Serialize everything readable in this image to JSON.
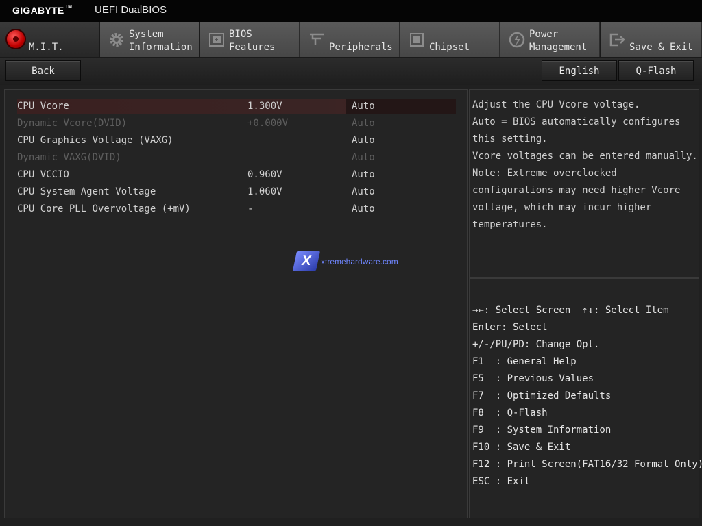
{
  "header": {
    "brand": "GIGABYTE",
    "brand_tm": "TM",
    "product": "UEFI DualBIOS"
  },
  "tabs": [
    {
      "line1": "",
      "line2": "M.I.T.",
      "icon": "mit-icon",
      "active": true
    },
    {
      "line1": "System",
      "line2": "Information",
      "icon": "gear-icon"
    },
    {
      "line1": "BIOS",
      "line2": "Features",
      "icon": "bios-chip-icon"
    },
    {
      "line1": "",
      "line2": "Peripherals",
      "icon": "peripherals-icon"
    },
    {
      "line1": "",
      "line2": "Chipset",
      "icon": "chipset-icon"
    },
    {
      "line1": "Power",
      "line2": "Management",
      "icon": "power-icon"
    },
    {
      "line1": "",
      "line2": "Save & Exit",
      "icon": "exit-icon"
    }
  ],
  "toolbar": {
    "back_label": "Back",
    "language_label": "English",
    "qflash_label": "Q-Flash"
  },
  "settings": [
    {
      "name": "CPU Vcore",
      "value": "1.300V",
      "option": "Auto",
      "selected": true,
      "disabled": false
    },
    {
      "name": "Dynamic Vcore(DVID)",
      "value": "+0.000V",
      "option": "Auto",
      "disabled": true
    },
    {
      "name": "CPU Graphics Voltage (VAXG)",
      "value": "",
      "option": "Auto",
      "disabled": false
    },
    {
      "name": "Dynamic VAXG(DVID)",
      "value": "",
      "option": "Auto",
      "disabled": true
    },
    {
      "name": "CPU VCCIO",
      "value": "0.960V",
      "option": "Auto",
      "disabled": false
    },
    {
      "name": "CPU System Agent Voltage",
      "value": "1.060V",
      "option": "Auto",
      "disabled": false
    },
    {
      "name": "CPU Core PLL Overvoltage (+mV)",
      "value": "-",
      "option": "Auto",
      "disabled": false
    }
  ],
  "help_text": [
    "Adjust the CPU Vcore voltage.",
    "Auto = BIOS automatically configures",
    "this setting.",
    "Vcore voltages can be entered manually.",
    "Note: Extreme overclocked",
    "configurations may need higher Vcore",
    "voltage, which may incur higher",
    "temperatures."
  ],
  "key_help": [
    "→←: Select Screen  ↑↓: Select Item",
    "Enter: Select",
    "+/-/PU/PD: Change Opt.",
    "F1  : General Help",
    "F5  : Previous Values",
    "F7  : Optimized Defaults",
    "F8  : Q-Flash",
    "F9  : System Information",
    "F10 : Save & Exit",
    "F12 : Print Screen(FAT16/32 Format Only)",
    "ESC : Exit"
  ],
  "watermark": {
    "logo": "X",
    "text": "xtremehardware.com"
  },
  "colors": {
    "accent_red": "#d40000",
    "selection_bg": "#3a2222",
    "disabled_text": "#5e5e5e",
    "watermark_blue": "#6f86ff"
  }
}
